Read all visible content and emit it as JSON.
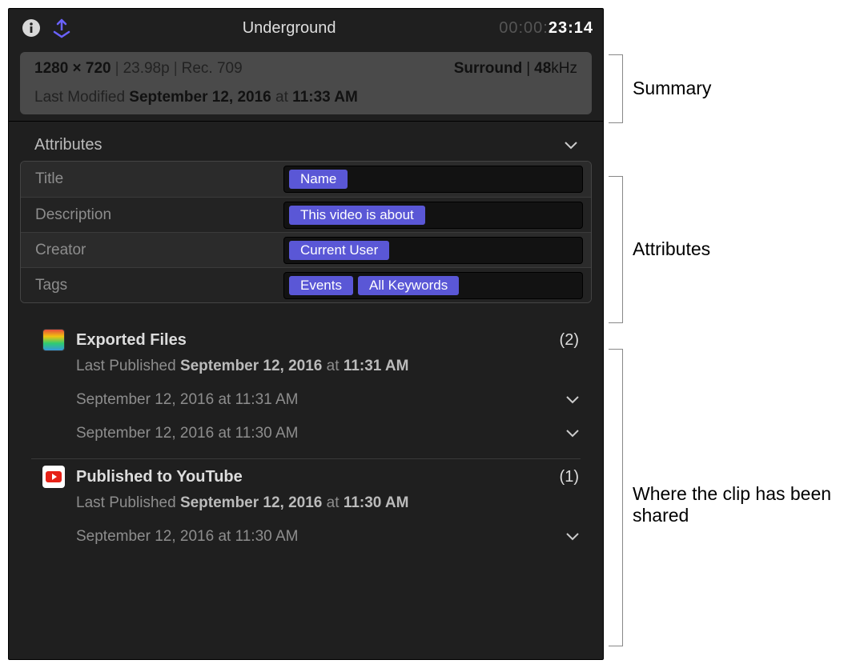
{
  "header": {
    "title": "Underground",
    "timecode_dim": "00:00:",
    "timecode_bright": "23:14"
  },
  "summary": {
    "resolution": "1280 × 720",
    "framerate": "23.98p",
    "colorspace": "Rec. 709",
    "audio_format": "Surround",
    "audio_rate_value": "48",
    "audio_rate_unit": "kHz",
    "modified_prefix": "Last Modified",
    "modified_date": "September 12, 2016",
    "modified_at": "at",
    "modified_time": "11:33 AM"
  },
  "attributes": {
    "section_label": "Attributes",
    "rows": [
      {
        "label": "Title",
        "tokens": [
          "Name"
        ]
      },
      {
        "label": "Description",
        "tokens": [
          "This video is about"
        ]
      },
      {
        "label": "Creator",
        "tokens": [
          "Current User"
        ]
      },
      {
        "label": "Tags",
        "tokens": [
          "Events",
          "All Keywords"
        ]
      }
    ]
  },
  "shares": [
    {
      "icon": "exported",
      "title": "Exported Files",
      "count": "(2)",
      "last_prefix": "Last Published",
      "last_date": "September 12, 2016",
      "last_at": "at",
      "last_time": "11:31 AM",
      "items": [
        "September 12, 2016 at 11:31 AM",
        "September 12, 2016 at 11:30 AM"
      ]
    },
    {
      "icon": "youtube",
      "title": "Published to YouTube",
      "count": "(1)",
      "last_prefix": "Last Published",
      "last_date": "September 12, 2016",
      "last_at": "at",
      "last_time": "11:30 AM",
      "items": [
        "September 12, 2016 at 11:30 AM"
      ]
    }
  ],
  "callouts": {
    "summary": "Summary",
    "attributes": "Attributes",
    "shared": "Where the clip has been shared"
  }
}
